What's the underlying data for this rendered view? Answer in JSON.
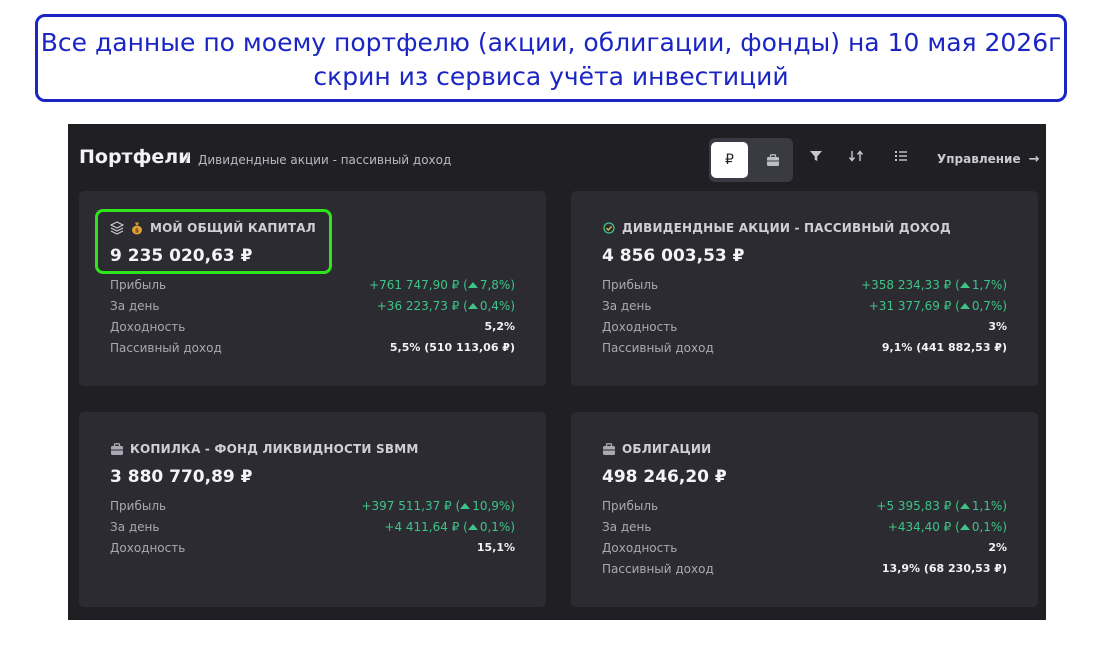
{
  "banner": {
    "line1": "Все данные по моему портфелю (акции, облигации, фонды) на 10 мая 2026г",
    "line2": "скрин из сервиса учёта инвестиций"
  },
  "header": {
    "title": "Портфели",
    "separator": "/",
    "breadcrumb": "Дивидендные акции - пассивный доход",
    "currency_toggle": {
      "rub": "₽",
      "selected": "rub"
    },
    "manage_label": "Управление",
    "manage_arrow": "→"
  },
  "cards": [
    {
      "title": "МОЙ ОБЩИЙ КАПИТАЛ",
      "icons": [
        "layers-icon",
        "money-bag-icon"
      ],
      "value": "9 235 020,63 ₽",
      "highlighted": true,
      "rows": [
        {
          "label": "Прибыль",
          "value": "+761 747,90 ₽ (",
          "pct": "7,8%)",
          "tone": "positive"
        },
        {
          "label": "За день",
          "value": "+36 223,73 ₽ (",
          "pct": "0,4%)",
          "tone": "positive"
        },
        {
          "label": "Доходность",
          "value": "5,2%",
          "tone": "neutral"
        },
        {
          "label": "Пассивный доход",
          "value": "5,5% (510 113,06 ₽)",
          "tone": "neutral"
        }
      ]
    },
    {
      "title": "ДИВИДЕНДНЫЕ АКЦИИ - ПАССИВНЫЙ ДОХОД",
      "icons": [
        "check-circle-icon"
      ],
      "value": "4 856 003,53 ₽",
      "rows": [
        {
          "label": "Прибыль",
          "value": "+358 234,33 ₽ (",
          "pct": "1,7%)",
          "tone": "positive"
        },
        {
          "label": "За день",
          "value": "+31 377,69 ₽ (",
          "pct": "0,7%)",
          "tone": "positive"
        },
        {
          "label": "Доходность",
          "value": "3%",
          "tone": "neutral"
        },
        {
          "label": "Пассивный доход",
          "value": "9,1% (441 882,53 ₽)",
          "tone": "neutral"
        }
      ]
    },
    {
      "title": "КОПИЛКА - ФОНД ЛИКВИДНОСТИ SBMM",
      "icons": [
        "briefcase-icon"
      ],
      "value": "3 880 770,89 ₽",
      "rows": [
        {
          "label": "Прибыль",
          "value": "+397 511,37 ₽ (",
          "pct": "10,9%)",
          "tone": "positive"
        },
        {
          "label": "За день",
          "value": "+4 411,64 ₽ (",
          "pct": "0,1%)",
          "tone": "positive"
        },
        {
          "label": "Доходность",
          "value": "15,1%",
          "tone": "neutral"
        }
      ]
    },
    {
      "title": "ОБЛИГАЦИИ",
      "icons": [
        "briefcase-icon"
      ],
      "value": "498 246,20 ₽",
      "rows": [
        {
          "label": "Прибыль",
          "value": "+5 395,83 ₽ (",
          "pct": "1,1%)",
          "tone": "positive"
        },
        {
          "label": "За день",
          "value": "+434,40 ₽ (",
          "pct": "0,1%)",
          "tone": "positive"
        },
        {
          "label": "Доходность",
          "value": "2%",
          "tone": "neutral"
        },
        {
          "label": "Пассивный доход",
          "value": "13,9% (68 230,53 ₽)",
          "tone": "neutral"
        }
      ]
    }
  ],
  "colors": {
    "background": "#202024",
    "card": "#2b2b31",
    "positive": "#3ec487",
    "banner_accent": "#1a25c4",
    "highlight": "#2ee51c"
  }
}
